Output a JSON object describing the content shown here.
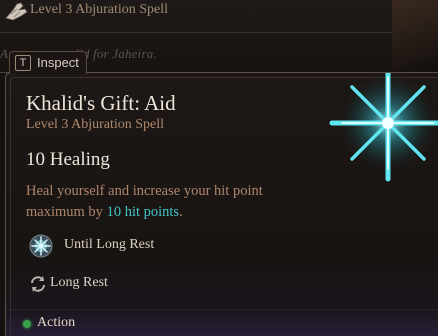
{
  "background_panel": {
    "header_text": "Level 3 Abjuration Spell",
    "faded_text": "A___ ___ ___lid for Jaheira."
  },
  "inspect": {
    "key": "T",
    "label": "Inspect"
  },
  "tooltip": {
    "title": "Khalid's Gift: Aid",
    "subtitle": "Level 3 Abjuration Spell",
    "healing": "10 Healing",
    "description_before": "Heal yourself and increase your hit point maximum by ",
    "description_highlight": "10 hit points",
    "description_after": ".",
    "duration": "Until Long Rest",
    "recharge": "Long Rest",
    "action_type": "Action"
  },
  "colors": {
    "highlight": "#41c6c8",
    "subtitle": "#b08a6c",
    "action_dot": "#3aa04a"
  },
  "icons": {
    "spell": "radiant-starburst-icon",
    "duration": "sparkle-orb-icon",
    "recharge": "cycle-arrows-icon",
    "header": "gauntlet-icon"
  }
}
